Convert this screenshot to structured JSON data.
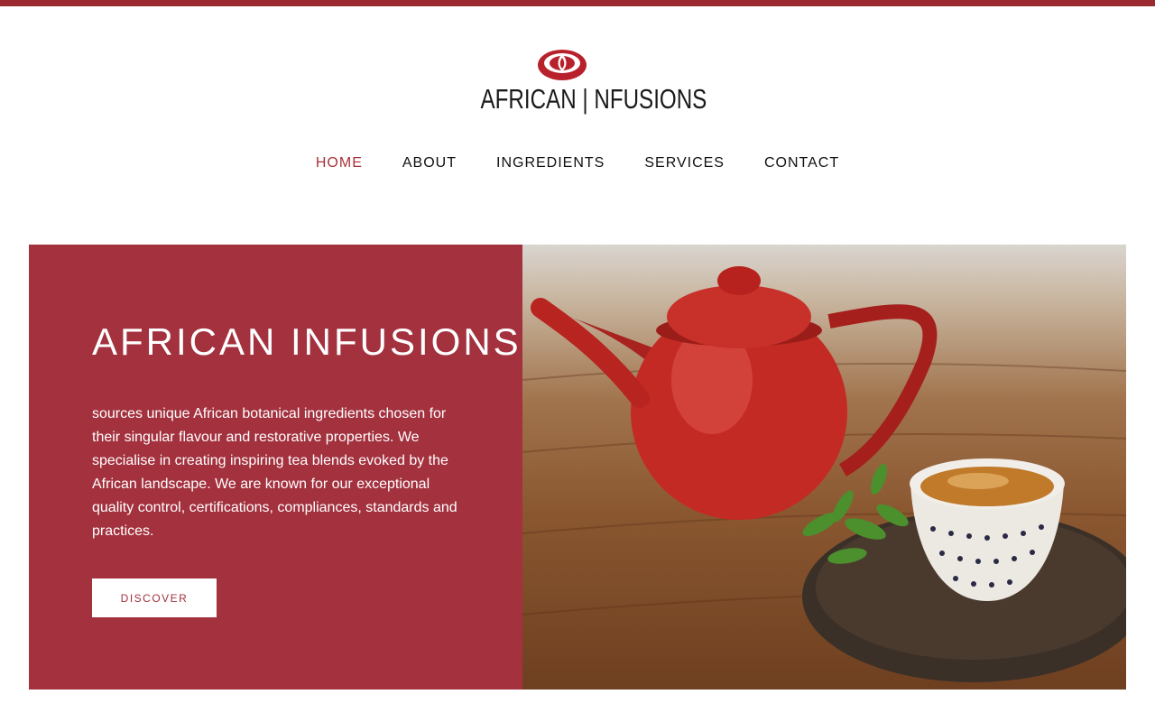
{
  "brand": {
    "logo_text": "AFRICAN | NFUSIONS",
    "accent_color": "#a3313e",
    "top_bar_color": "#9b2a30"
  },
  "nav": {
    "items": [
      {
        "label": "HOME",
        "active": true
      },
      {
        "label": "ABOUT",
        "active": false
      },
      {
        "label": "INGREDIENTS",
        "active": false
      },
      {
        "label": "SERVICES",
        "active": false
      },
      {
        "label": "CONTACT",
        "active": false
      }
    ]
  },
  "hero": {
    "title": "AFRICAN INFUSIONS",
    "body": "sources unique African botanical ingredients chosen for their singular flavour and restorative properties. We specialise in creating inspiring tea blends evoked by the African landscape. We are known for our exceptional quality control, certifications, compliances, standards and practices.",
    "cta_label": "DISCOVER",
    "image_subject": "red enamel teapot and cup of tea on wooden table"
  }
}
